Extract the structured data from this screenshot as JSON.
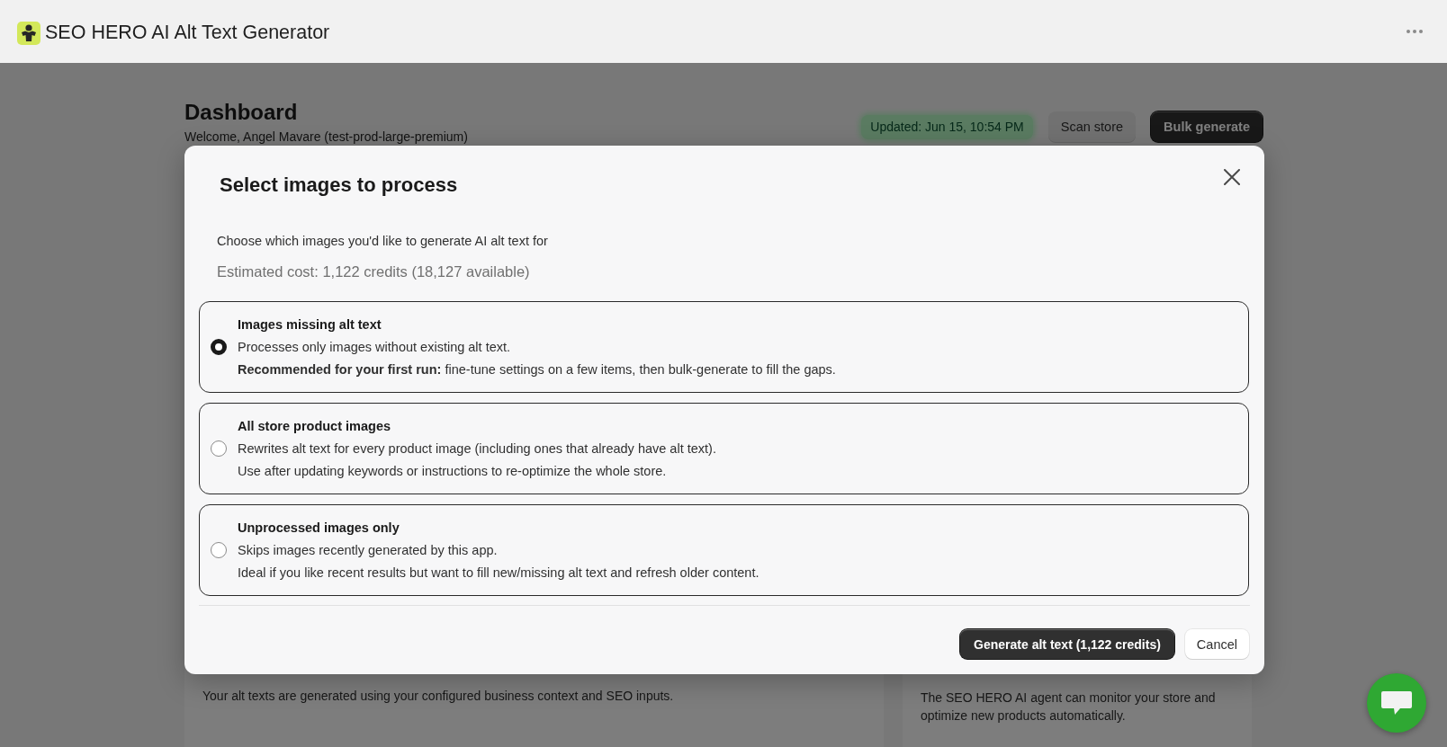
{
  "app_bar": {
    "title": "SEO HERO AI Alt Text Generator"
  },
  "page": {
    "title": "Dashboard",
    "subtitle": "Welcome, Angel Mavare (test-prod-large-premium)",
    "status_badge": "Updated: Jun 15, 10:54 PM",
    "actions": [
      {
        "label": "Scan store",
        "kind": "secondary"
      },
      {
        "label": "Bulk generate",
        "kind": "primary"
      }
    ],
    "cards": [
      {
        "text": "Your alt texts are generated using your configured business context and SEO inputs."
      },
      {
        "text": "The SEO HERO AI agent can monitor your store and optimize new products automatically."
      }
    ]
  },
  "modal": {
    "title": "Select images to process",
    "description": "Choose which images you'd like to generate AI alt text for",
    "estimate": "Estimated cost: 1,122 credits (18,127 available)",
    "options": [
      {
        "title": "Images missing alt text",
        "lines": [
          "Processes only images without existing alt text.",
          "**Recommended for your first run:** fine-tune settings on a few items, then bulk-generate to fill the gaps."
        ],
        "selected": true
      },
      {
        "title": "All store product images",
        "lines": [
          "Rewrites alt text for every product image (including ones that already have alt text).",
          "Use after updating keywords or instructions to re-optimize the whole store."
        ],
        "selected": false
      },
      {
        "title": "Unprocessed images only",
        "lines": [
          "Skips images recently generated by this app.",
          "Ideal if you like recent results but want to fill new/missing alt text and refresh older content."
        ],
        "selected": false
      }
    ],
    "actions": [
      {
        "label": "Generate alt text (1,122 credits)",
        "kind": "primary"
      },
      {
        "label": "Cancel",
        "kind": "secondary"
      }
    ]
  }
}
